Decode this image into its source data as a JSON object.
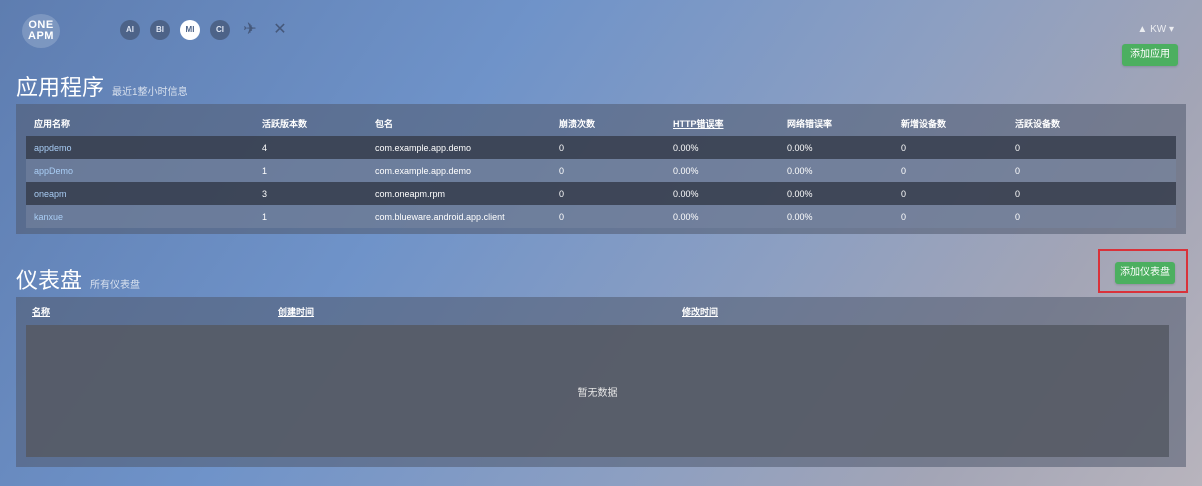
{
  "header": {
    "logo_line1": "ONE",
    "logo_line2": "APM",
    "nav_icons": [
      {
        "label": "AI",
        "name": "nav-ai-icon"
      },
      {
        "label": "BI",
        "name": "nav-bi-icon"
      },
      {
        "label": "MI",
        "name": "nav-mi-icon"
      },
      {
        "label": "CI",
        "name": "nav-ci-icon"
      },
      {
        "label": "✈",
        "name": "nav-plane-icon"
      },
      {
        "label": "✕",
        "name": "nav-tools-icon"
      }
    ],
    "user": "▲ KW ▾",
    "add_app_label": "添加应用"
  },
  "apps": {
    "title": "应用程序",
    "subtitle": "最近1整小时信息",
    "columns": [
      "应用名称",
      "活跃版本数",
      "包名",
      "崩溃次数",
      "HTTP错误率",
      "网络错误率",
      "新增设备数",
      "活跃设备数"
    ],
    "rows": [
      {
        "name": "appdemo",
        "versions": "4",
        "package": "com.example.app.demo",
        "crashes": "0",
        "http_err": "0.00%",
        "net_err": "0.00%",
        "new_devices": "0",
        "active_devices": "0"
      },
      {
        "name": "appDemo",
        "versions": "1",
        "package": "com.example.app.demo",
        "crashes": "0",
        "http_err": "0.00%",
        "net_err": "0.00%",
        "new_devices": "0",
        "active_devices": "0"
      },
      {
        "name": "oneapm",
        "versions": "3",
        "package": "com.oneapm.rpm",
        "crashes": "0",
        "http_err": "0.00%",
        "net_err": "0.00%",
        "new_devices": "0",
        "active_devices": "0"
      },
      {
        "name": "kanxue",
        "versions": "1",
        "package": "com.blueware.android.app.client",
        "crashes": "0",
        "http_err": "0.00%",
        "net_err": "0.00%",
        "new_devices": "0",
        "active_devices": "0"
      }
    ]
  },
  "dashboard": {
    "title": "仪表盘",
    "subtitle": "所有仪表盘",
    "add_label": "添加仪表盘",
    "columns": [
      "名称",
      "创建时间",
      "修改时间"
    ],
    "empty_text": "暂无数据"
  },
  "colors": {
    "accent_green": "#4caf60",
    "highlight_red": "#d9323a",
    "link_blue": "#a9cdf5"
  }
}
